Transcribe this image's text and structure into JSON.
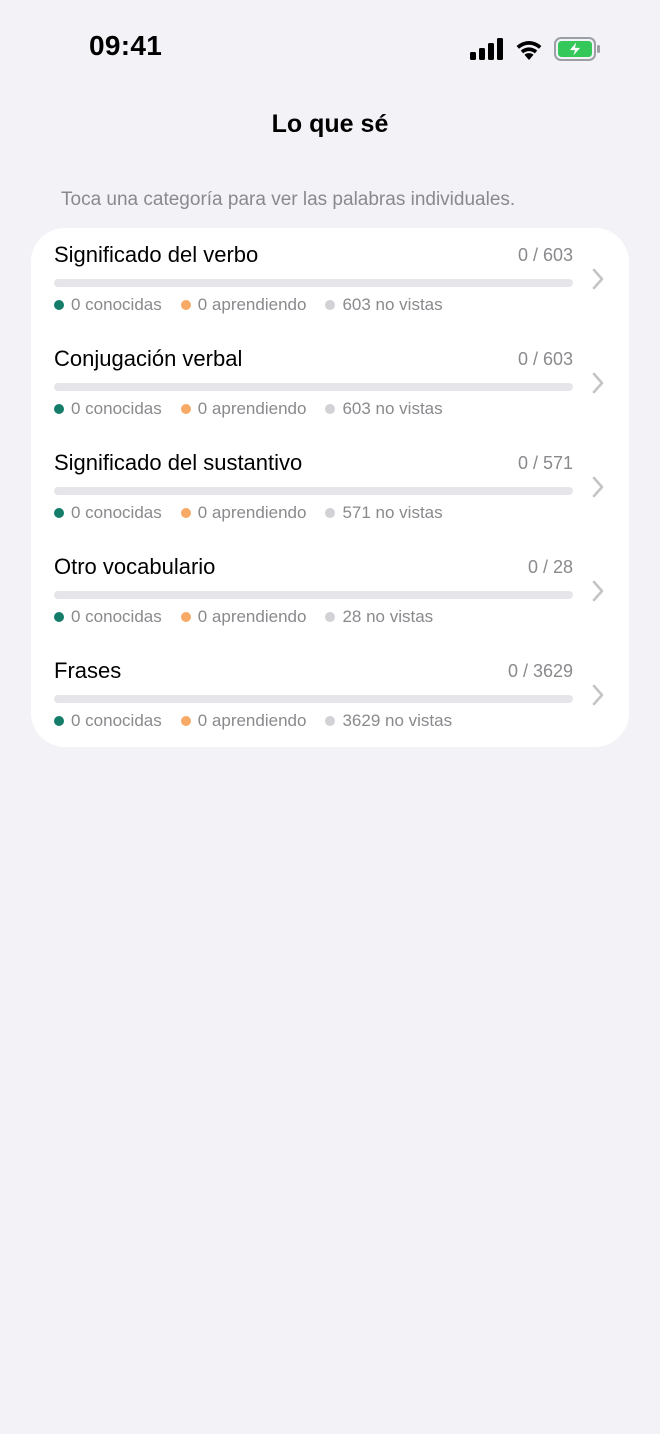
{
  "status_bar": {
    "time": "09:41",
    "icons": [
      "cellular-signal-icon",
      "wifi-icon",
      "battery-charging-icon"
    ]
  },
  "nav": {
    "title": "Lo que sé"
  },
  "hint": "Toca una categoría para ver las palabras individuales.",
  "colors": {
    "known": "#137d6a",
    "learning": "#f7aa66",
    "unseen": "#d1d1d6",
    "background": "#f2f2f7"
  },
  "categories": [
    {
      "name": "Significado del verbo",
      "count": "0 / 603",
      "progress": 0,
      "known": "0 conocidas",
      "learning": "0 aprendiendo",
      "unseen": "603 no vistas"
    },
    {
      "name": "Conjugación verbal",
      "count": "0 / 603",
      "progress": 0,
      "known": "0 conocidas",
      "learning": "0 aprendiendo",
      "unseen": "603 no vistas"
    },
    {
      "name": "Significado del sustantivo",
      "count": "0 / 571",
      "progress": 0,
      "known": "0 conocidas",
      "learning": "0 aprendiendo",
      "unseen": "571 no vistas"
    },
    {
      "name": "Otro vocabulario",
      "count": "0 / 28",
      "progress": 0,
      "known": "0 conocidas",
      "learning": "0 aprendiendo",
      "unseen": "28 no vistas"
    },
    {
      "name": "Frases",
      "count": "0 / 3629",
      "progress": 0,
      "known": "0 conocidas",
      "learning": "0 aprendiendo",
      "unseen": "3629 no vistas"
    }
  ]
}
